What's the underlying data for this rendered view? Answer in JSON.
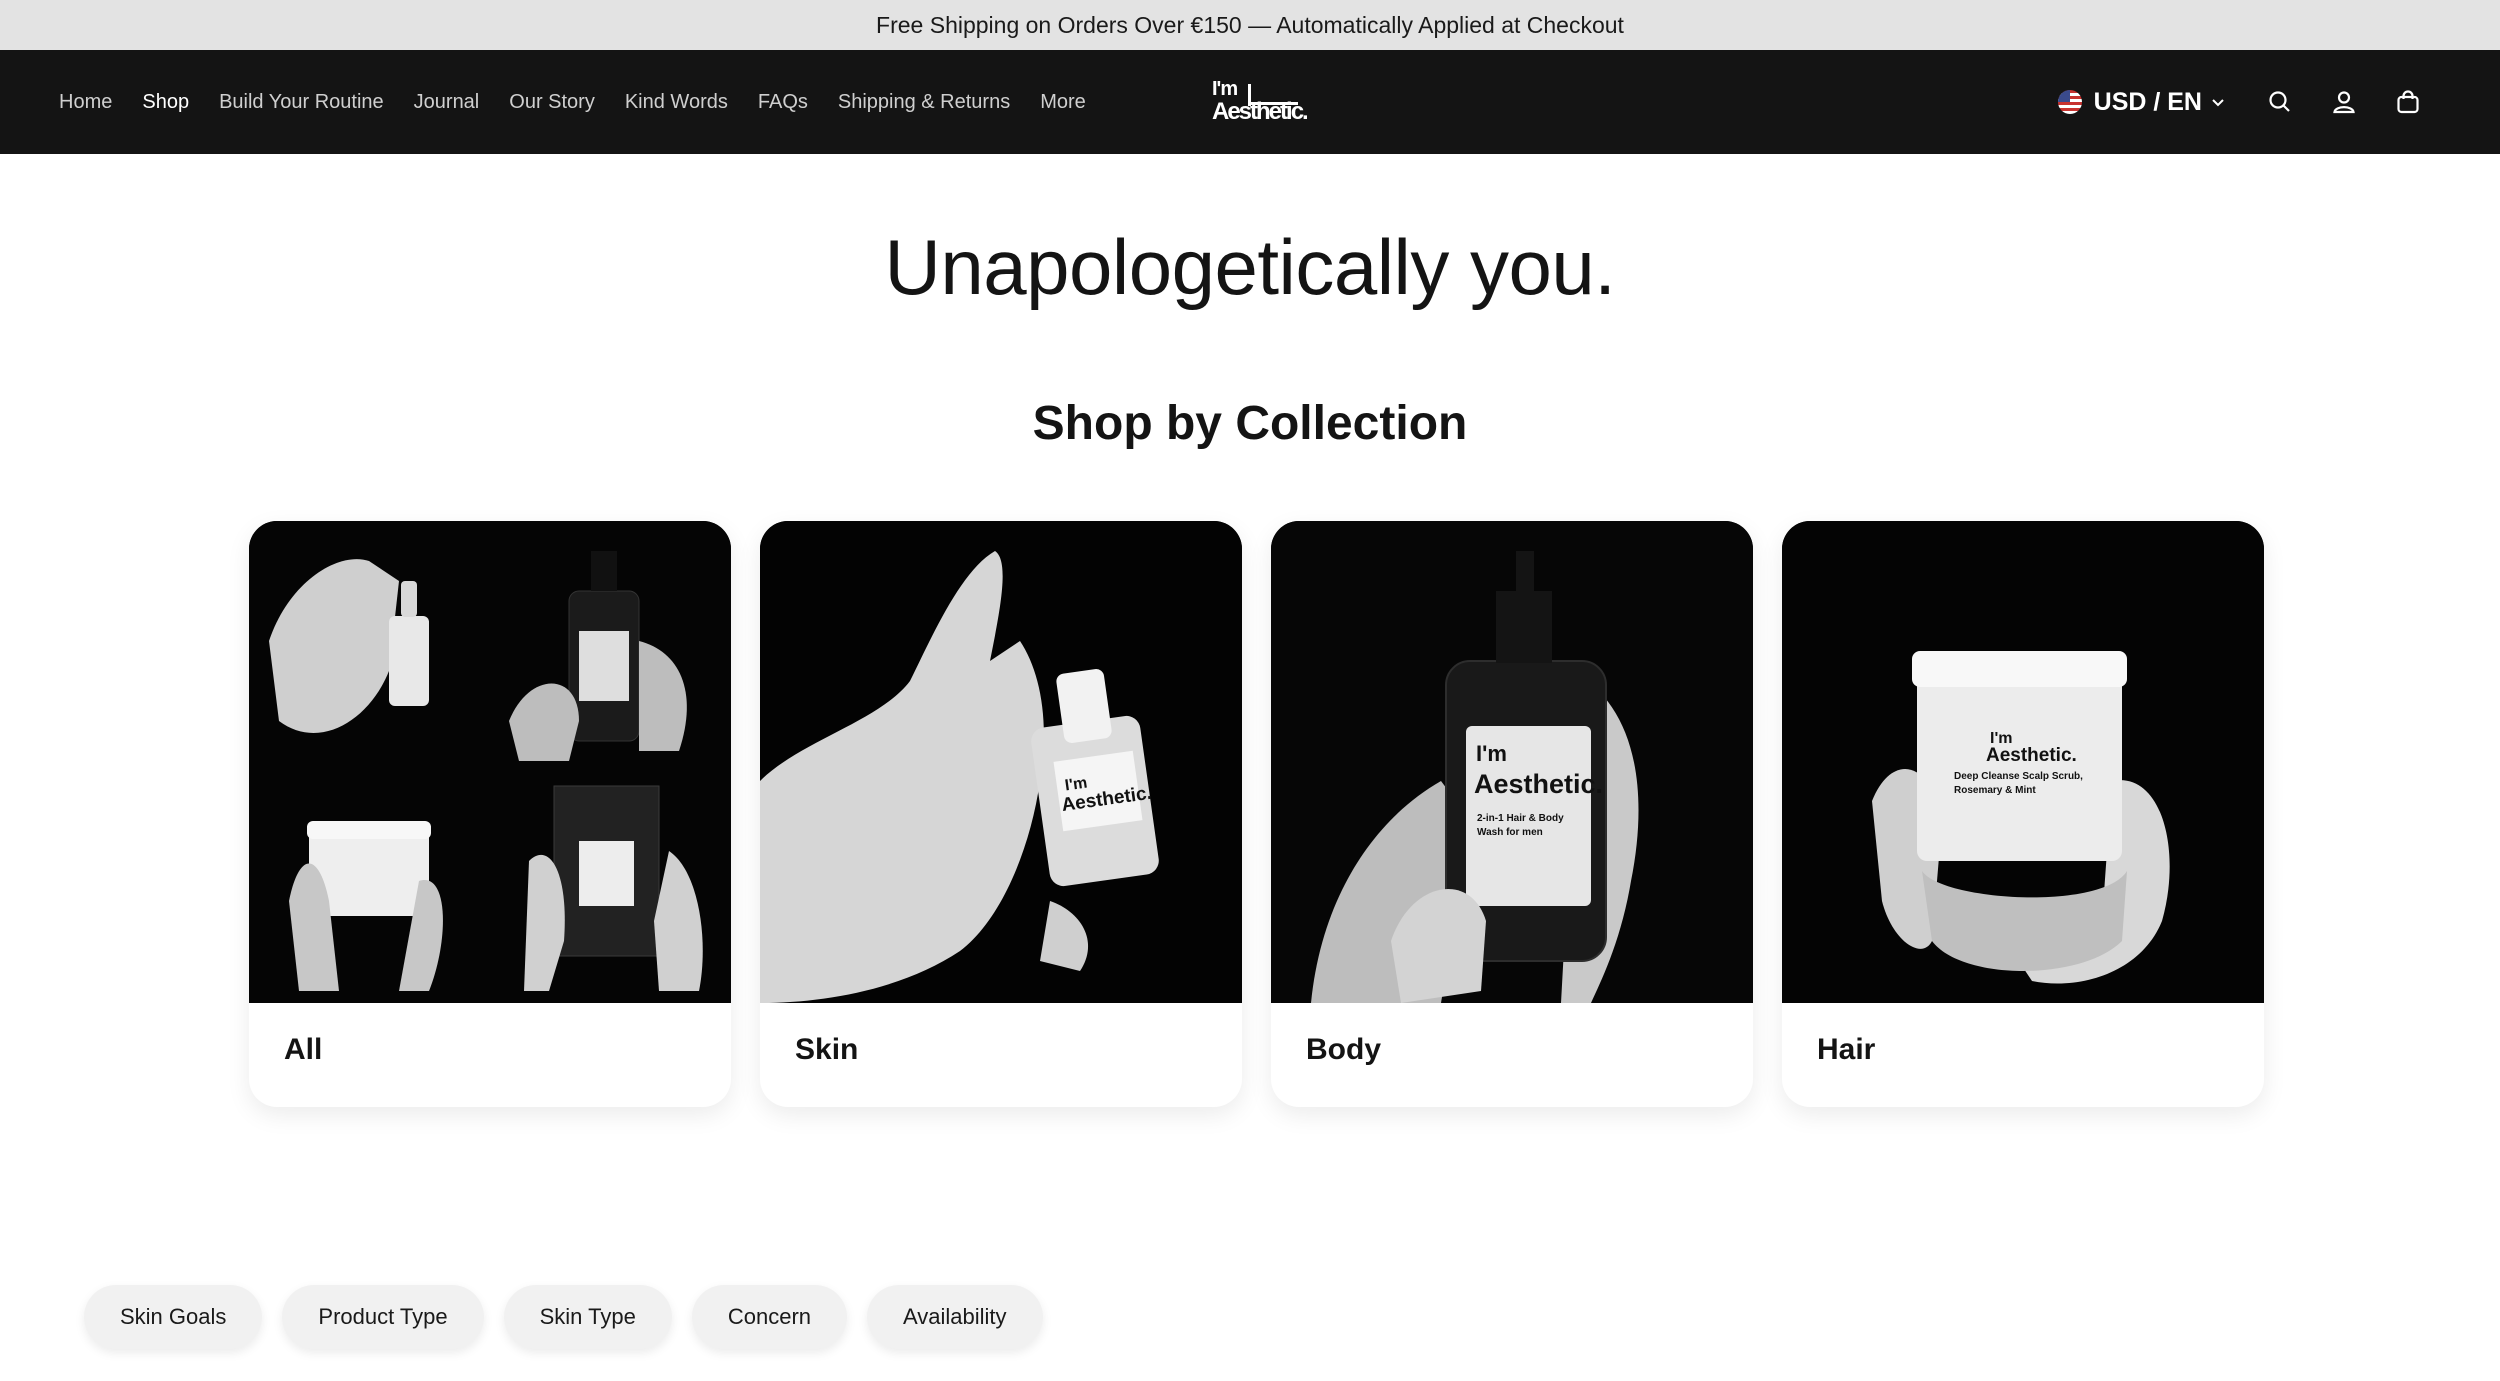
{
  "announcement": "Free Shipping on Orders Over €150 — Automatically Applied at Checkout",
  "nav": {
    "items": [
      {
        "label": "Home",
        "active": false
      },
      {
        "label": "Shop",
        "active": true
      },
      {
        "label": "Build Your Routine",
        "active": false
      },
      {
        "label": "Journal",
        "active": false
      },
      {
        "label": "Our Story",
        "active": false
      },
      {
        "label": "Kind Words",
        "active": false
      },
      {
        "label": "FAQs",
        "active": false
      },
      {
        "label": "Shipping & Returns",
        "active": false
      },
      {
        "label": "More",
        "active": false
      }
    ]
  },
  "logo": {
    "line1": "I'm",
    "line2": "Aesthetic."
  },
  "header_tools": {
    "locale": "USD / EN",
    "icons": [
      "us-flag-icon",
      "chevron-down-icon",
      "search-icon",
      "account-icon",
      "cart-icon"
    ]
  },
  "hero": {
    "title": "Unapologetically you."
  },
  "collections": {
    "title": "Shop by Collection",
    "cards": [
      {
        "label": "All"
      },
      {
        "label": "Skin"
      },
      {
        "label": "Body"
      },
      {
        "label": "Hair"
      }
    ],
    "product_labels": {
      "body_wash_1": "2-in-1 Hair & Body",
      "body_wash_2": "Wash for men",
      "scrub_1": "Deep Cleanse Scalp Scrub,",
      "scrub_2": "Rosemary & Mint"
    }
  },
  "filters": [
    "Skin Goals",
    "Product Type",
    "Skin Type",
    "Concern",
    "Availability"
  ],
  "colors": {
    "header_bg": "#141414",
    "announce_bg": "#e3e3e3",
    "page_bg": "#ffffff"
  }
}
